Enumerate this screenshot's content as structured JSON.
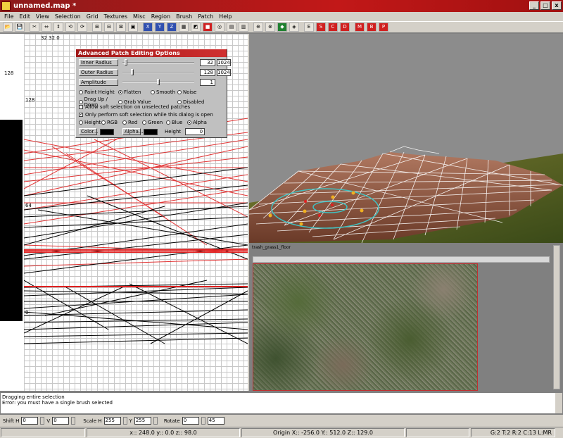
{
  "window": {
    "title": "unnamed.map *",
    "min": "_",
    "max": "□",
    "close": "x"
  },
  "menu": [
    "File",
    "Edit",
    "View",
    "Selection",
    "Grid",
    "Textures",
    "Misc",
    "Region",
    "Brush",
    "Patch",
    "Help"
  ],
  "toolbar": {
    "buttons": [
      "📂",
      "💾",
      "✂",
      "⇔",
      "⇕",
      "⟲",
      "⟳",
      "⊞",
      "⊟",
      "⊠",
      "▣",
      "X",
      "Y",
      "Z",
      "▦",
      "◩",
      "■",
      "◎",
      "▤",
      "▥",
      "⊕",
      "⊗",
      "◆",
      "◈",
      "E",
      "S",
      "C",
      "D",
      "M",
      "B",
      "P"
    ]
  },
  "grid_view": {
    "label_top": "32 32 0",
    "label_128a": "128",
    "label_128b": "128",
    "label_64": "64",
    "label_0": "0"
  },
  "dialog": {
    "title": "Advanced Patch Editing Options",
    "inner_radius_label": "Inner Radius",
    "inner_radius_value": "32",
    "inner_radius_max": "1024",
    "outer_radius_label": "Outer Radius",
    "outer_radius_value": "128",
    "outer_radius_max": "1024",
    "amplitude_label": "Amplitude",
    "amplitude_value": "1",
    "mode_row1": [
      "Paint Height",
      "Flatten",
      "Smooth",
      "Noise"
    ],
    "mode_row2": [
      "Drag Up / Down",
      "Grab Value",
      "Disabled"
    ],
    "check1": "Allow soft selection on unselected patches",
    "check2": "Only perform soft selection while this dialog is open",
    "channel_row": [
      "Height",
      "RGB",
      "Red",
      "Green",
      "Blue",
      "Alpha"
    ],
    "color_button": "Color...",
    "alpha_button": "Alpha...",
    "height_label": "Height",
    "height_value": "0"
  },
  "texture_view": {
    "header": "trash_grass1_floor"
  },
  "console": {
    "lines": [
      "Dragging entire selection",
      "Error: you must have a single brush selected"
    ]
  },
  "bottom": {
    "shift_h_label": "Shift H",
    "shift_h": "0",
    "v_label": "V",
    "v": "0",
    "scale_h_label": "Scale H",
    "scale_h": "255",
    "y_label": "Y",
    "y": "255",
    "rotate_label": "Rotate",
    "rotate": "0",
    "rotate_step": "45"
  },
  "status": {
    "cursor": "x:: 248.0  y:: 0.0  z:: 98.0",
    "origin": "Origin X:: -256.0  Y:: 512.0  Z:: 129.0",
    "grid": "G:2 T:2 R:2 C:13 L:MR"
  },
  "colors": {
    "title_bar": "#c21818",
    "mesh_red": "#e02020",
    "selection_ring": "#40c0c0",
    "terrain_green": "#4a5a20",
    "terrain_brown": "#8a5a40"
  }
}
